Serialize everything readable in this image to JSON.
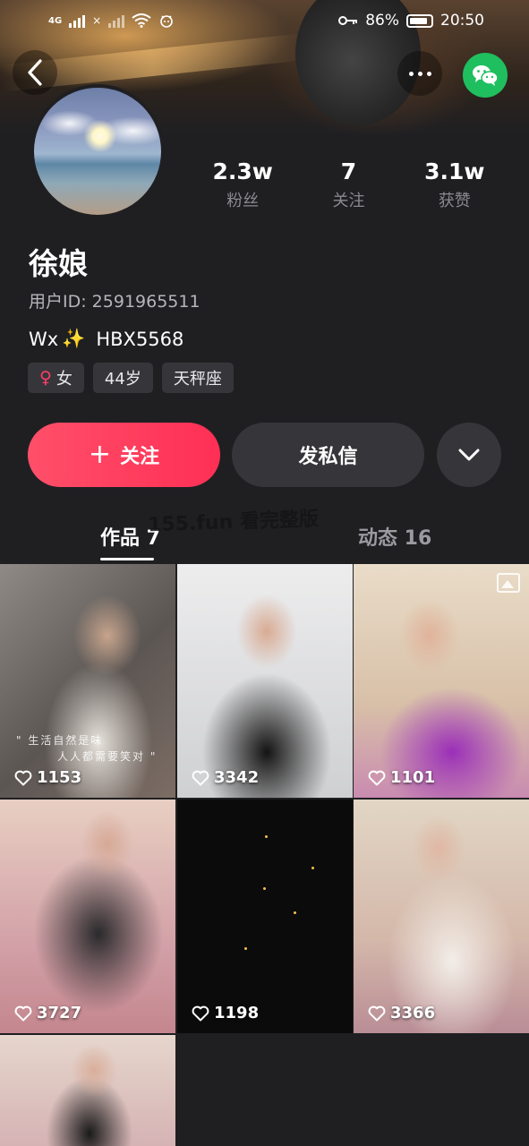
{
  "status_bar": {
    "network_label": "4G",
    "x_mark": "×",
    "battery_percent": "86%",
    "battery_level": 0.86,
    "time": "20:50"
  },
  "header": {
    "back_icon": "back-arrow-icon",
    "more_icon": "more-dots-icon",
    "wechat_icon": "wechat-icon",
    "wechat_color": "#1fbf5f"
  },
  "profile": {
    "name": "徐娘",
    "user_id": "用户ID: 2591965511",
    "bio_prefix": "Wx",
    "bio_sparkle": "✨",
    "bio_suffix": "HBX5568",
    "stats": [
      {
        "value": "2.3w",
        "label": "粉丝"
      },
      {
        "value": "7",
        "label": "关注"
      },
      {
        "value": "3.1w",
        "label": "获赞"
      }
    ],
    "tags": {
      "gender_icon": "♀",
      "gender": "女",
      "age": "44岁",
      "zodiac": "天秤座"
    }
  },
  "actions": {
    "follow_plus": "+",
    "follow_label": "关注",
    "message_label": "发私信",
    "follow_color": "#ff3b5c"
  },
  "tabs": {
    "works": "作品 7",
    "feed": "动态 16",
    "watermark": "155.fun 看完整版"
  },
  "grid": {
    "items": [
      {
        "likes": "1153",
        "caption_line1": "\" 生活自然是味",
        "caption_line2": "人人都需要笑对 \""
      },
      {
        "likes": "3342"
      },
      {
        "likes": "1101"
      },
      {
        "likes": "3727"
      },
      {
        "likes": "1198"
      },
      {
        "likes": "3366"
      },
      {
        "likes": ""
      }
    ]
  }
}
